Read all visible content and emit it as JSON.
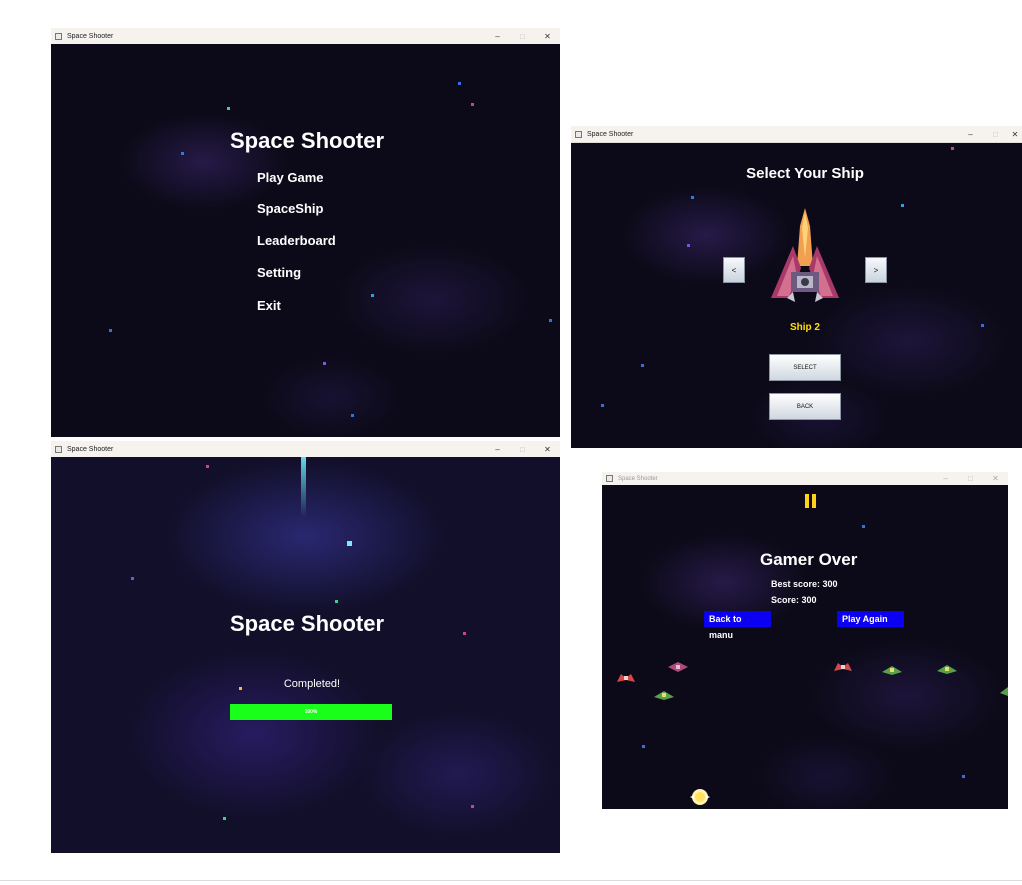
{
  "windows": {
    "menu": {
      "title": "Space Shooter",
      "heading": "Space Shooter",
      "items": [
        "Play Game",
        "SpaceShip",
        "Leaderboard",
        "Setting",
        "Exit"
      ]
    },
    "ship_select": {
      "title": "Space Shooter",
      "heading": "Select Your Ship",
      "prev_label": "<",
      "next_label": ">",
      "ship_name": "Ship 2",
      "select_label": "SELECT",
      "back_label": "BACK"
    },
    "loading": {
      "title": "Space Shooter",
      "heading": "Space Shooter",
      "status": "Completed!",
      "progress": 1.0,
      "progress_label": "100%"
    },
    "game_over": {
      "title": "Space Shooter",
      "heading": "Gamer Over",
      "best_score": "Best score: 300",
      "score": "Score: 300",
      "back_label": "Back to manu",
      "play_again_label": "Play Again"
    }
  },
  "window_controls": {
    "minimize": "–",
    "maximize": "□",
    "close": "✕"
  },
  "colors": {
    "space_bg": "#0c0a18",
    "ship_name": "#ffe000",
    "progress": "#19ff19",
    "game_button": "#0b00f2",
    "pause_icon": "#ffd21a"
  },
  "icons": [
    "java-app-icon",
    "spaceship-icon",
    "pause-icon",
    "enemy-ship-icon",
    "player-ship-icon"
  ]
}
